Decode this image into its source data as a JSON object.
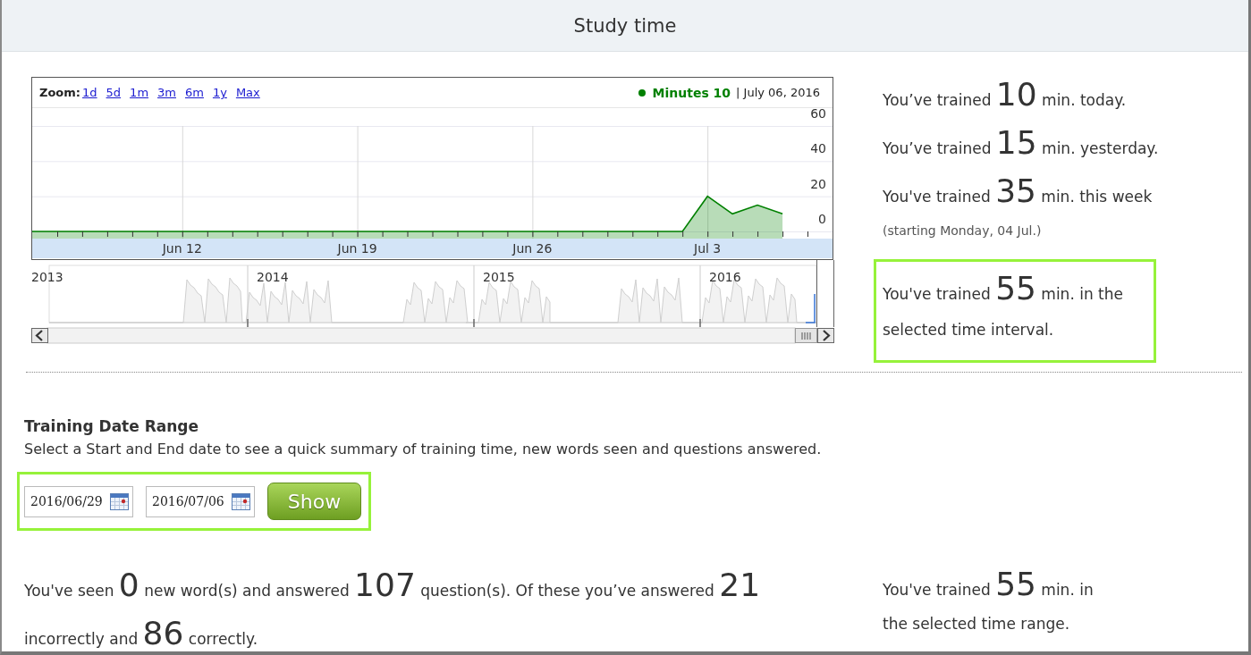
{
  "header": {
    "title": "Study time"
  },
  "chart": {
    "zoom_label": "Zoom:",
    "zoom_options": [
      {
        "label": "1d"
      },
      {
        "label": "5d"
      },
      {
        "label": "1m"
      },
      {
        "label": "3m"
      },
      {
        "label": "6m"
      },
      {
        "label": "1y"
      },
      {
        "label": "Max"
      }
    ],
    "legend": {
      "value": "10",
      "separator": "|",
      "date": "July 06, 2016"
    },
    "chart_data": {
      "type": "area",
      "categories": [
        null,
        null,
        null,
        null,
        null,
        null,
        "Jun 12",
        null,
        null,
        null,
        null,
        null,
        null,
        "Jun 19",
        null,
        null,
        null,
        null,
        null,
        null,
        "Jun 26",
        null,
        null,
        null,
        null,
        null,
        null,
        "Jul 3",
        null,
        null,
        null
      ],
      "grid": true,
      "series": [
        {
          "name": "Minutes",
          "color": "#008000",
          "values": [
            0,
            0,
            0,
            0,
            0,
            0,
            0,
            0,
            0,
            0,
            0,
            0,
            0,
            0,
            0,
            0,
            0,
            0,
            0,
            0,
            0,
            0,
            0,
            0,
            0,
            0,
            0,
            20,
            10,
            15,
            10
          ]
        }
      ],
      "ylim": [
        0,
        60
      ],
      "yticks": [
        0,
        20,
        40,
        60
      ]
    }
  },
  "navigator": {
    "year_labels": [
      "2013",
      "2014",
      "2015",
      "2016"
    ]
  },
  "stats": [
    {
      "prefix": "You’ve trained",
      "value": "10",
      "suffix": "min. today."
    },
    {
      "prefix": "You’ve trained",
      "value": "15",
      "suffix": "min. yesterday."
    },
    {
      "prefix": "You've trained",
      "value": "35",
      "suffix": "min. this week",
      "note": "(starting Monday, 04 Jul.)"
    }
  ],
  "interval_stat": {
    "prefix": "You've trained",
    "value": "55",
    "suffix": "min. in the selected time interval.",
    "highlighted": true
  },
  "date_range": {
    "title": "Training Date Range",
    "description": "Select a Start and End date to see a quick summary of training time, new words seen and questions answered.",
    "highlighted": true,
    "start_date": {
      "value": "2016/06/29"
    },
    "end_date": {
      "value": "2016/07/06"
    },
    "button": "Show"
  },
  "summary": {
    "parts": [
      {
        "kind": "text",
        "text": "You've seen"
      },
      {
        "kind": "number",
        "text": "0"
      },
      {
        "kind": "text",
        "text": "new word(s) and answered"
      },
      {
        "kind": "number",
        "text": "107"
      },
      {
        "kind": "text",
        "text": "question(s). Of these you’ve answered"
      },
      {
        "kind": "number",
        "text": "21"
      },
      {
        "kind": "text",
        "text": "incorrectly and"
      },
      {
        "kind": "number",
        "text": "86"
      },
      {
        "kind": "text",
        "text": "correctly."
      }
    ]
  },
  "range_stat": {
    "prefix": "You've trained",
    "value": "55",
    "suffix": "min. in the selected time range."
  }
}
